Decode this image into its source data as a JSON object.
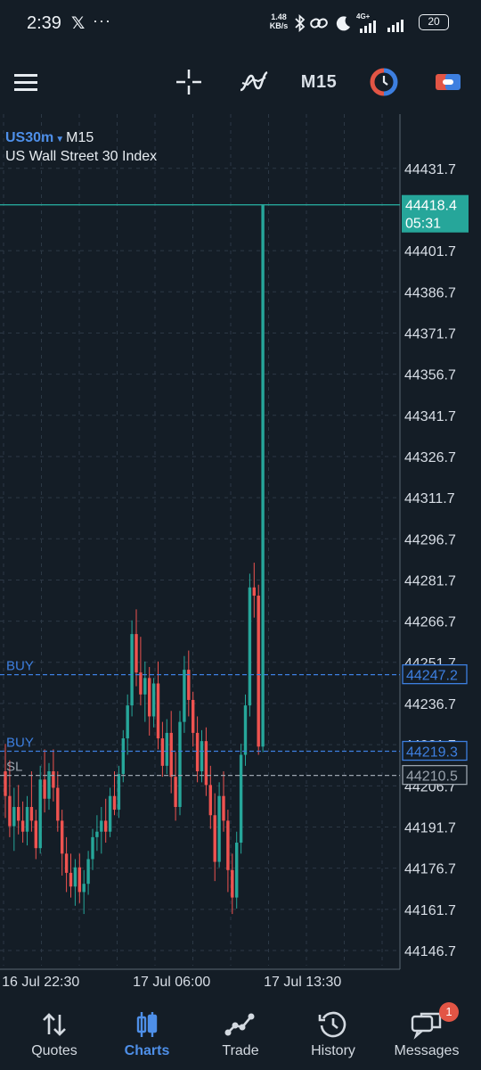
{
  "status_bar": {
    "time": "2:39",
    "x_app": "𝕏",
    "more": "···",
    "net_speed_value": "1.48",
    "net_speed_unit": "KB/s",
    "network": "4G+",
    "battery": "20"
  },
  "toolbar": {
    "menu_icon": "hamburger-menu-icon",
    "crosshair_icon": "crosshair-icon",
    "indicators_icon": "indicators-icon",
    "timeframe": "M15",
    "one_click_icon": "one-click-trading-icon",
    "account_icon": "account-icon"
  },
  "chart": {
    "symbol": "US30m",
    "timeframe": "M15",
    "description": "US Wall Street 30 Index"
  },
  "chart_data": {
    "type": "candlestick",
    "symbol": "US30m",
    "timeframe": "M15",
    "y_ticks": [
      "44431.7",
      "44401.7",
      "44386.7",
      "44371.7",
      "44356.7",
      "44341.7",
      "44326.7",
      "44311.7",
      "44296.7",
      "44281.7",
      "44266.7",
      "44251.7",
      "44236.7",
      "44221.7",
      "44206.7",
      "44191.7",
      "44176.7",
      "44161.7",
      "44146.7"
    ],
    "ylim": [
      44140.2,
      44437.8
    ],
    "x_ticks": [
      {
        "label": "16 Jul 22:30",
        "bar": 9
      },
      {
        "label": "17 Jul 06:00",
        "bar": 39
      },
      {
        "label": "17 Jul 13:30",
        "bar": 69
      }
    ],
    "bid_price": "44418.4",
    "countdown": "05:31",
    "orders": [
      {
        "type": "BUY",
        "price": "44247.2"
      },
      {
        "type": "BUY",
        "price": "44219.3"
      },
      {
        "type": "SL",
        "price": "44210.5"
      }
    ],
    "candles": [
      [
        44212,
        44222,
        44195,
        44203
      ],
      [
        44203,
        44216,
        44188,
        44192
      ],
      [
        44192,
        44206,
        44183,
        44199
      ],
      [
        44199,
        44207,
        44189,
        44194
      ],
      [
        44194,
        44201,
        44186,
        44190
      ],
      [
        44190,
        44203,
        44185,
        44199
      ],
      [
        44199,
        44212,
        44190,
        44194
      ],
      [
        44194,
        44198,
        44180,
        44184
      ],
      [
        44184,
        44214,
        44182,
        44209
      ],
      [
        44209,
        44220,
        44197,
        44202
      ],
      [
        44202,
        44215,
        44198,
        44212
      ],
      [
        44212,
        44220,
        44201,
        44206
      ],
      [
        44206,
        44212,
        44190,
        44194
      ],
      [
        44194,
        44198,
        44174,
        44182
      ],
      [
        44182,
        44188,
        44168,
        44175
      ],
      [
        44175,
        44182,
        44166,
        44170
      ],
      [
        44170,
        44180,
        44163,
        44177
      ],
      [
        44177,
        44182,
        44164,
        44168
      ],
      [
        44168,
        44176,
        44160,
        44171
      ],
      [
        44171,
        44183,
        44167,
        44180
      ],
      [
        44180,
        44191,
        44176,
        44188
      ],
      [
        44188,
        44196,
        44183,
        44190
      ],
      [
        44190,
        44199,
        44182,
        44194
      ],
      [
        44194,
        44202,
        44186,
        44190
      ],
      [
        44190,
        44206,
        44188,
        44203
      ],
      [
        44203,
        44212,
        44196,
        44198
      ],
      [
        44198,
        44214,
        44195,
        44211
      ],
      [
        44211,
        44227,
        44208,
        44224
      ],
      [
        44224,
        44240,
        44218,
        44236
      ],
      [
        44236,
        44267,
        44232,
        44262
      ],
      [
        44262,
        44271,
        44243,
        44248
      ],
      [
        44248,
        44261,
        44236,
        44240
      ],
      [
        44240,
        44252,
        44230,
        44246
      ],
      [
        44246,
        44250,
        44225,
        44232
      ],
      [
        44232,
        44246,
        44228,
        44244
      ],
      [
        44244,
        44252,
        44220,
        44224
      ],
      [
        44224,
        44230,
        44210,
        44214
      ],
      [
        44214,
        44231,
        44211,
        44226
      ],
      [
        44226,
        44234,
        44204,
        44210
      ],
      [
        44210,
        44219,
        44194,
        44199
      ],
      [
        44199,
        44234,
        44196,
        44230
      ],
      [
        44230,
        44254,
        44226,
        44249
      ],
      [
        44249,
        44256,
        44232,
        44238
      ],
      [
        44238,
        44241,
        44221,
        44226
      ],
      [
        44226,
        44232,
        44208,
        44212
      ],
      [
        44212,
        44227,
        44208,
        44223
      ],
      [
        44223,
        44228,
        44203,
        44207
      ],
      [
        44207,
        44214,
        44191,
        44196
      ],
      [
        44196,
        44204,
        44172,
        44179
      ],
      [
        44179,
        44208,
        44177,
        44203
      ],
      [
        44203,
        44212,
        44190,
        44194
      ],
      [
        44194,
        44198,
        44168,
        44176
      ],
      [
        44176,
        44182,
        44160,
        44166
      ],
      [
        44166,
        44190,
        44162,
        44186
      ],
      [
        44186,
        44222,
        44182,
        44218
      ],
      [
        44218,
        44240,
        44214,
        44236
      ],
      [
        44236,
        44284,
        44232,
        44279
      ],
      [
        44279,
        44288,
        44268,
        44276
      ],
      [
        44276,
        44280,
        44218,
        44221
      ],
      [
        44221,
        44418.4,
        44219,
        44418.4
      ]
    ]
  },
  "bottom_nav": [
    {
      "label": "Quotes",
      "icon": "quotes-arrows-icon",
      "active": false
    },
    {
      "label": "Charts",
      "icon": "charts-candles-icon",
      "active": true
    },
    {
      "label": "Trade",
      "icon": "trade-trend-icon",
      "active": false
    },
    {
      "label": "History",
      "icon": "history-clock-icon",
      "active": false
    },
    {
      "label": "Messages",
      "icon": "messages-chat-icon",
      "active": false,
      "badge": "1"
    }
  ],
  "colors": {
    "background": "#141d26",
    "bull": "#26a69a",
    "bear": "#ef5350",
    "order_line": "#3d7fe0",
    "sl_line": "#9aa3ad",
    "accent": "#4e8fe8",
    "badge": "#e25545"
  }
}
